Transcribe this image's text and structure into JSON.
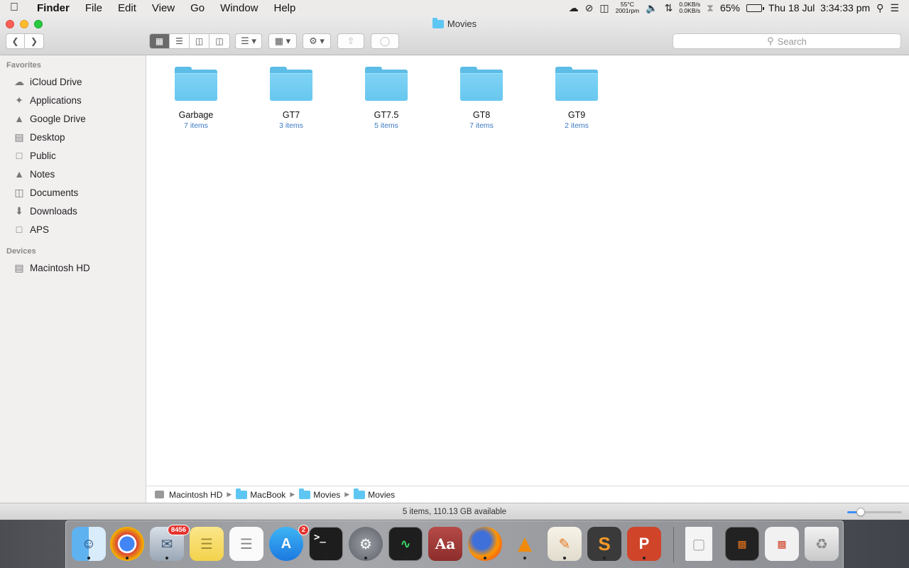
{
  "menubar": {
    "app": "Finder",
    "menus": [
      "File",
      "Edit",
      "View",
      "Go",
      "Window",
      "Help"
    ],
    "temp": "55°C",
    "fan": "2001rpm",
    "net_up": "0.0KB/s",
    "net_down": "0.0KB/s",
    "battery": "65%",
    "datetime": "Thu 18 Jul  3:34:33 pm"
  },
  "window": {
    "title": "Movies",
    "search_placeholder": "Search"
  },
  "sidebar": {
    "favorites_header": "Favorites",
    "favorites": [
      {
        "label": "iCloud Drive",
        "icon": "cloud-icon"
      },
      {
        "label": "Applications",
        "icon": "applications-icon"
      },
      {
        "label": "Google Drive",
        "icon": "google-drive-icon"
      },
      {
        "label": "Desktop",
        "icon": "desktop-icon"
      },
      {
        "label": "Public",
        "icon": "folder-icon"
      },
      {
        "label": "Notes",
        "icon": "google-drive-icon"
      },
      {
        "label": "Documents",
        "icon": "documents-icon"
      },
      {
        "label": "Downloads",
        "icon": "downloads-icon"
      },
      {
        "label": "APS",
        "icon": "folder-icon"
      }
    ],
    "devices_header": "Devices",
    "devices": [
      {
        "label": "Macintosh HD",
        "icon": "disk-icon"
      }
    ]
  },
  "folders": [
    {
      "name": "Garbage",
      "count": "7 items"
    },
    {
      "name": "GT7",
      "count": "3 items"
    },
    {
      "name": "GT7.5",
      "count": "5 items"
    },
    {
      "name": "GT8",
      "count": "7 items"
    },
    {
      "name": "GT9",
      "count": "2 items"
    }
  ],
  "pathbar": [
    "Macintosh HD",
    "MacBook",
    "Movies",
    "Movies"
  ],
  "status": "5 items, 110.13 GB available",
  "icon_size_slider": 0.25,
  "dock": {
    "mail_badge": "8456",
    "appstore_badge": "2"
  },
  "colors": {
    "folder": "#67c7ef",
    "item_count": "#3a78c2",
    "close": "#fc5f57",
    "minimize": "#fdbc2e",
    "maximize": "#28c840"
  }
}
